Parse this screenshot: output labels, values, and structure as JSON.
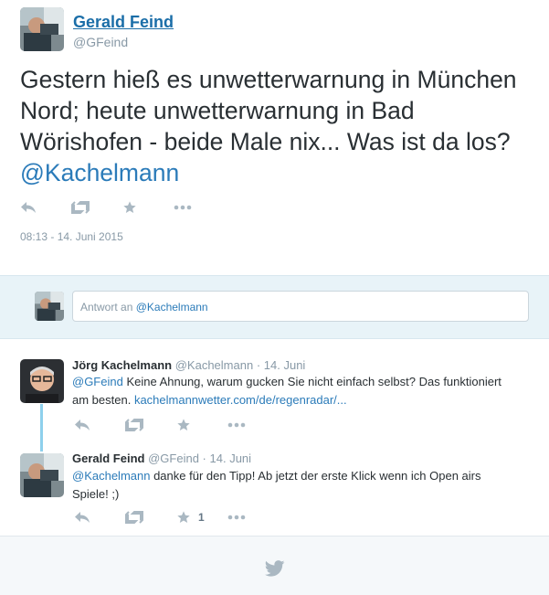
{
  "main_tweet": {
    "author_name": "Gerald Feind",
    "author_handle": "@GFeind",
    "text": "Gestern hieß es unwetterwarnung in München Nord; heute unwetterwarnung in Bad Wörishofen - beide Male nix... Was ist da los? ",
    "mention": "@Kachelmann",
    "timestamp": "08:13 - 14. Juni 2015"
  },
  "reply_box": {
    "placeholder_prefix": "Antwort an ",
    "placeholder_mention": "@Kachelmann"
  },
  "conversation": [
    {
      "author_name": "Jörg Kachelmann",
      "author_handle": "@Kachelmann",
      "separator": "·",
      "date": "14. Juni",
      "mention": "@GFeind",
      "text": " Keine Ahnung, warum gucken Sie nicht einfach selbst? Das funktioniert am besten. ",
      "link": "kachelmannwetter.com/de/regenradar/...",
      "like_count": ""
    },
    {
      "author_name": "Gerald Feind",
      "author_handle": "@GFeind",
      "separator": "·",
      "date": "14. Juni",
      "mention": "@Kachelmann",
      "text": " danke für den Tipp! Ab jetzt der erste Klick wenn ich Open airs Spiele! ;)",
      "like_count": "1"
    }
  ],
  "icons": [
    "reply-icon",
    "retweet-icon",
    "favorite-star-icon",
    "more-dots-icon",
    "twitter-bird-icon"
  ],
  "colors": {
    "link": "#2b7bb9",
    "muted": "#8899a6",
    "action_icons": "#aab8c2",
    "reply_box_bg": "#e8f3f8",
    "thread_line": "#8ed0ec",
    "footer_bg": "#f5f8fa"
  }
}
